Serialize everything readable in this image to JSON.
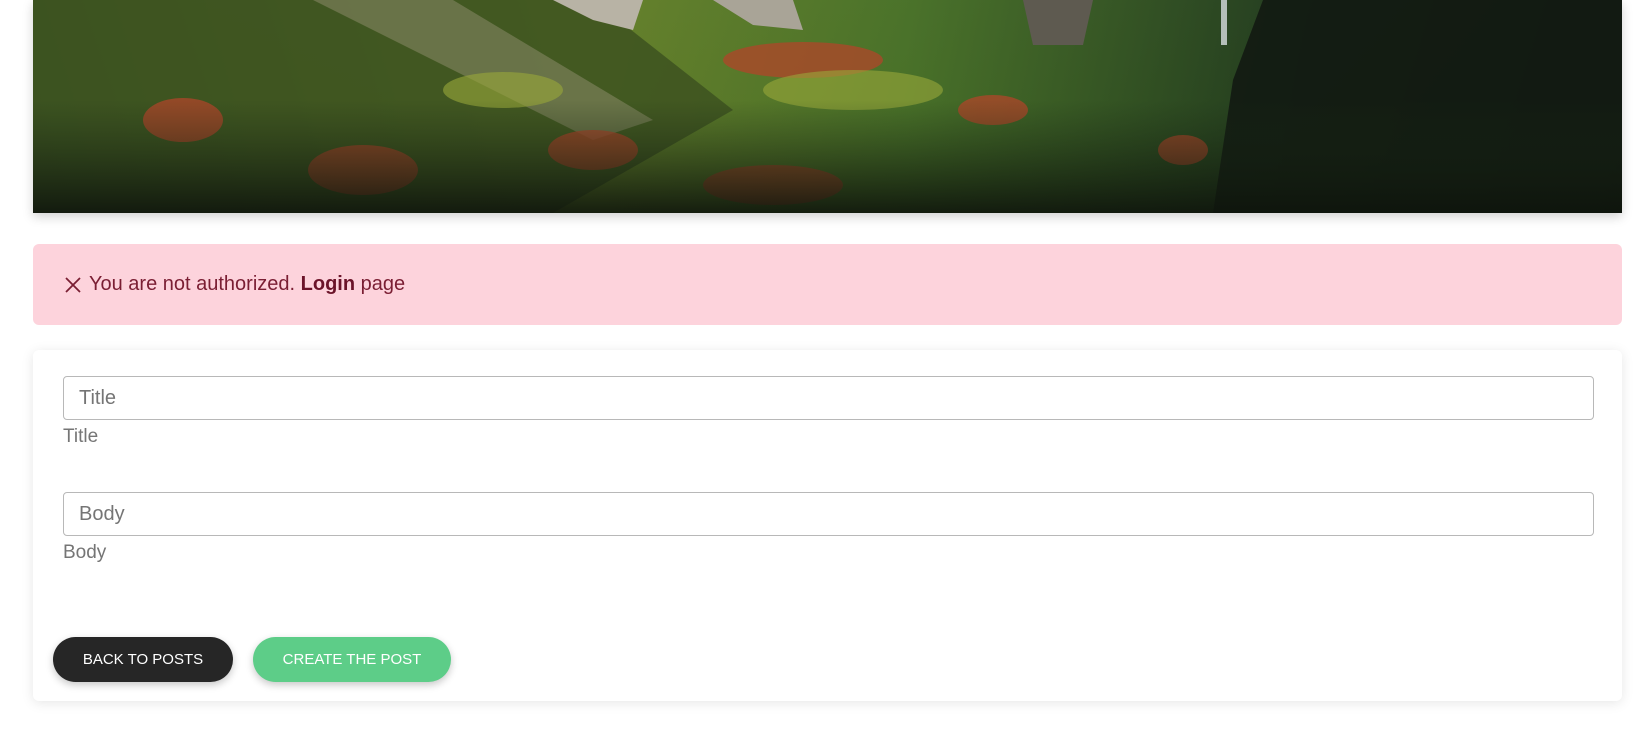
{
  "hero": {
    "image": "mountain-valley-forest-photo"
  },
  "alert": {
    "icon": "close-icon",
    "message": "You are not authorized.",
    "link_label": "Login",
    "suffix": "page",
    "background_color": "#fdd3dc",
    "text_color": "#7a1e33"
  },
  "form": {
    "title": {
      "placeholder": "Title",
      "value": "",
      "label": "Title"
    },
    "body": {
      "placeholder": "Body",
      "value": "",
      "label": "Body"
    },
    "back_button": {
      "label": "BACK TO POSTS",
      "color": "#262626"
    },
    "create_button": {
      "label": "CREATE THE POST",
      "color": "#5dcd88"
    }
  }
}
